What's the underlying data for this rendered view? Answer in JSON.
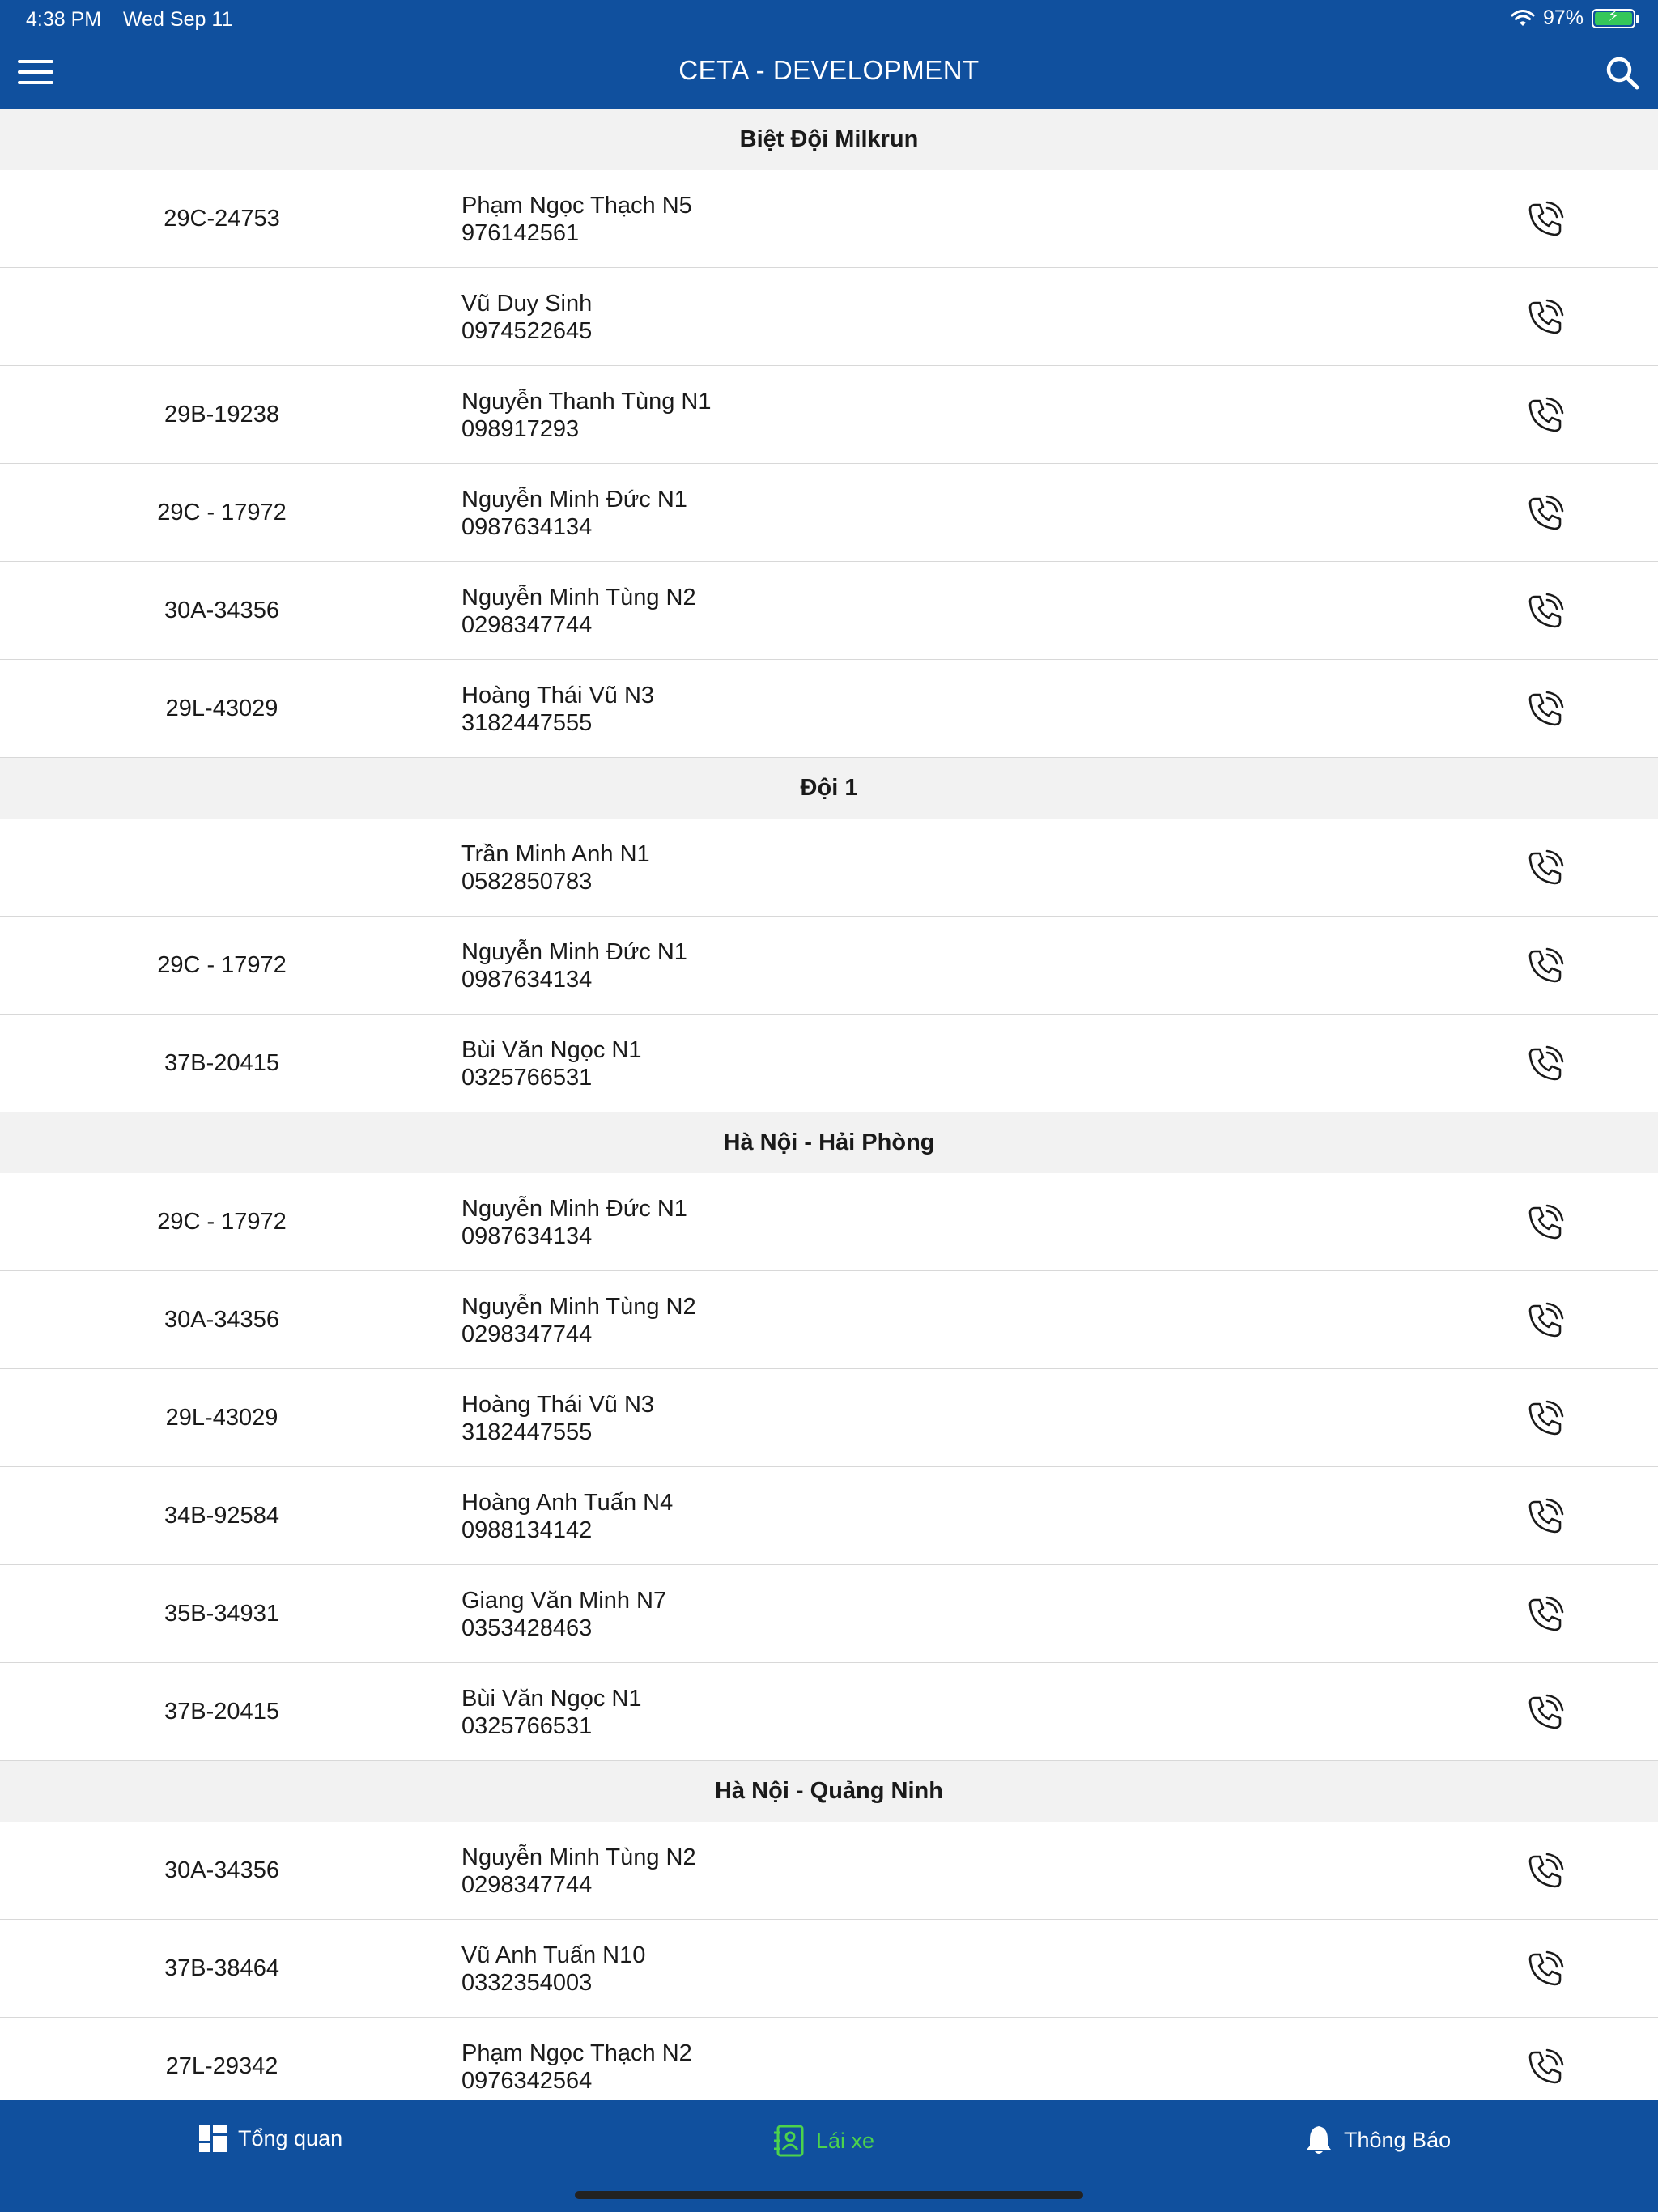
{
  "status_bar": {
    "time": "4:38 PM",
    "date": "Wed Sep 11",
    "battery": "97%"
  },
  "header": {
    "title": "CETA - DEVELOPMENT"
  },
  "sections": [
    {
      "title": "Biệt Đội Milkrun",
      "rows": [
        {
          "plate": "29C-24753",
          "name": "Phạm Ngọc Thạch N5",
          "phone": "976142561"
        },
        {
          "plate": "",
          "name": "Vũ Duy Sinh",
          "phone": "0974522645"
        },
        {
          "plate": "29B-19238",
          "name": "Nguyễn Thanh Tùng N1",
          "phone": "098917293"
        },
        {
          "plate": "29C - 17972",
          "name": "Nguyễn Minh Đức N1",
          "phone": "0987634134"
        },
        {
          "plate": "30A-34356",
          "name": "Nguyễn Minh Tùng N2",
          "phone": "0298347744"
        },
        {
          "plate": "29L-43029",
          "name": "Hoàng Thái Vũ N3",
          "phone": "3182447555"
        }
      ]
    },
    {
      "title": "Đội 1",
      "rows": [
        {
          "plate": "",
          "name": "Trần Minh Anh N1",
          "phone": "0582850783"
        },
        {
          "plate": "29C - 17972",
          "name": "Nguyễn Minh Đức N1",
          "phone": "0987634134"
        },
        {
          "plate": "37B-20415",
          "name": "Bùi Văn Ngọc N1",
          "phone": "0325766531"
        }
      ]
    },
    {
      "title": "Hà Nội - Hải Phòng",
      "rows": [
        {
          "plate": "29C - 17972",
          "name": "Nguyễn Minh Đức N1",
          "phone": "0987634134"
        },
        {
          "plate": "30A-34356",
          "name": "Nguyễn Minh Tùng N2",
          "phone": "0298347744"
        },
        {
          "plate": "29L-43029",
          "name": "Hoàng Thái Vũ N3",
          "phone": "3182447555"
        },
        {
          "plate": "34B-92584",
          "name": "Hoàng Anh Tuấn N4",
          "phone": "0988134142"
        },
        {
          "plate": "35B-34931",
          "name": "Giang Văn Minh N7",
          "phone": "0353428463"
        },
        {
          "plate": "37B-20415",
          "name": "Bùi Văn Ngọc N1",
          "phone": "0325766531"
        }
      ]
    },
    {
      "title": "Hà Nội - Quảng Ninh",
      "rows": [
        {
          "plate": "30A-34356",
          "name": "Nguyễn Minh Tùng N2",
          "phone": "0298347744"
        },
        {
          "plate": "37B-38464",
          "name": "Vũ Anh Tuấn N10",
          "phone": "0332354003"
        },
        {
          "plate": "27L-29342",
          "name": "Phạm Ngọc Thạch N2",
          "phone": "0976342564"
        }
      ]
    }
  ],
  "tabs": [
    {
      "label": "Tổng quan",
      "icon": "dashboard-icon",
      "active": false
    },
    {
      "label": "Lái xe",
      "icon": "driver-contacts-icon",
      "active": true
    },
    {
      "label": "Thông Báo",
      "icon": "bell-icon",
      "active": false
    }
  ],
  "colors": {
    "primary": "#10509e",
    "active_tab": "#4cd34c",
    "section_bg": "#f2f2f2",
    "battery": "#35c75a"
  }
}
